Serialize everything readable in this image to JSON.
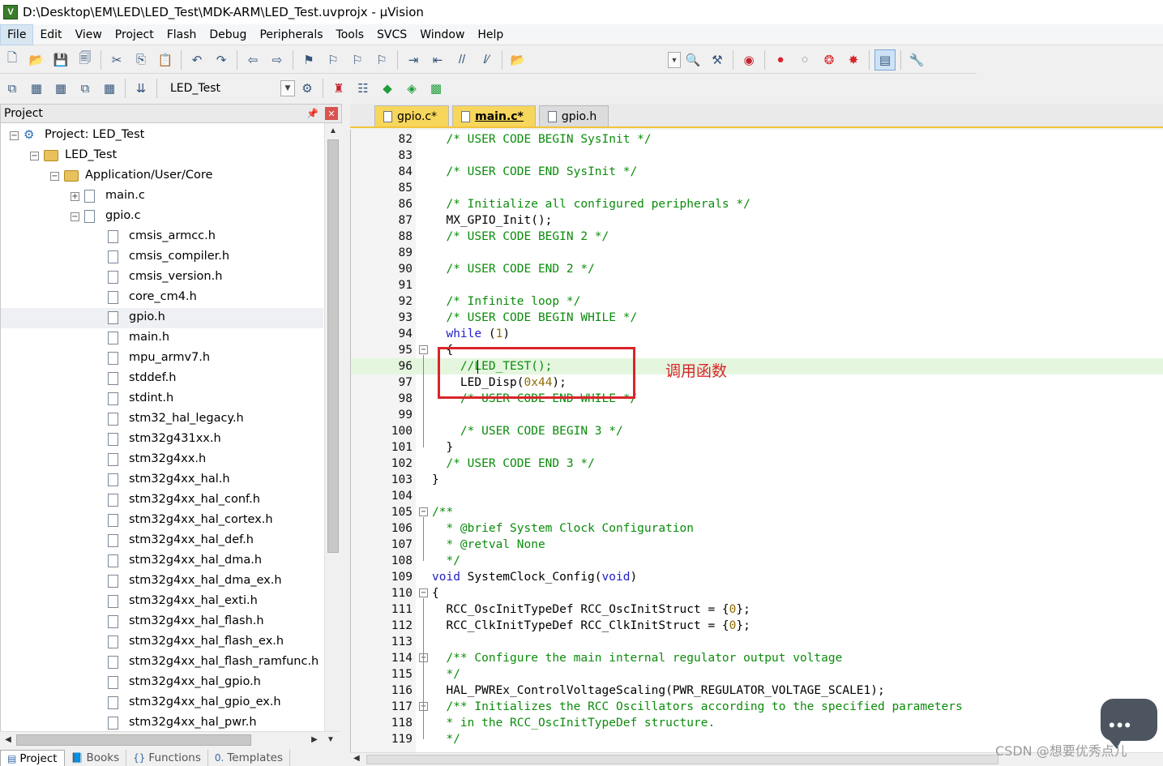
{
  "window": {
    "title": "D:\\Desktop\\EM\\LED\\LED_Test\\MDK-ARM\\LED_Test.uvprojx - µVision"
  },
  "menu": [
    "File",
    "Edit",
    "View",
    "Project",
    "Flash",
    "Debug",
    "Peripherals",
    "Tools",
    "SVCS",
    "Window",
    "Help"
  ],
  "toolbar": {
    "target": "LED_Test"
  },
  "project_pane": {
    "title": "Project",
    "tree": [
      {
        "label": "Project: LED_Test",
        "level": 0,
        "type": "project",
        "expander": "−"
      },
      {
        "label": "LED_Test",
        "level": 1,
        "type": "folder",
        "expander": "−"
      },
      {
        "label": "Application/User/Core",
        "level": 2,
        "type": "folder",
        "expander": "−"
      },
      {
        "label": "main.c",
        "level": 3,
        "type": "file",
        "expander": "+"
      },
      {
        "label": "gpio.c",
        "level": 3,
        "type": "file",
        "expander": "−"
      },
      {
        "label": "cmsis_armcc.h",
        "level": 4,
        "type": "file"
      },
      {
        "label": "cmsis_compiler.h",
        "level": 4,
        "type": "file"
      },
      {
        "label": "cmsis_version.h",
        "level": 4,
        "type": "file"
      },
      {
        "label": "core_cm4.h",
        "level": 4,
        "type": "file"
      },
      {
        "label": "gpio.h",
        "level": 4,
        "type": "file",
        "selected": true
      },
      {
        "label": "main.h",
        "level": 4,
        "type": "file"
      },
      {
        "label": "mpu_armv7.h",
        "level": 4,
        "type": "file"
      },
      {
        "label": "stddef.h",
        "level": 4,
        "type": "file"
      },
      {
        "label": "stdint.h",
        "level": 4,
        "type": "file"
      },
      {
        "label": "stm32_hal_legacy.h",
        "level": 4,
        "type": "file"
      },
      {
        "label": "stm32g431xx.h",
        "level": 4,
        "type": "file"
      },
      {
        "label": "stm32g4xx.h",
        "level": 4,
        "type": "file"
      },
      {
        "label": "stm32g4xx_hal.h",
        "level": 4,
        "type": "file"
      },
      {
        "label": "stm32g4xx_hal_conf.h",
        "level": 4,
        "type": "file"
      },
      {
        "label": "stm32g4xx_hal_cortex.h",
        "level": 4,
        "type": "file"
      },
      {
        "label": "stm32g4xx_hal_def.h",
        "level": 4,
        "type": "file"
      },
      {
        "label": "stm32g4xx_hal_dma.h",
        "level": 4,
        "type": "file"
      },
      {
        "label": "stm32g4xx_hal_dma_ex.h",
        "level": 4,
        "type": "file"
      },
      {
        "label": "stm32g4xx_hal_exti.h",
        "level": 4,
        "type": "file"
      },
      {
        "label": "stm32g4xx_hal_flash.h",
        "level": 4,
        "type": "file"
      },
      {
        "label": "stm32g4xx_hal_flash_ex.h",
        "level": 4,
        "type": "file"
      },
      {
        "label": "stm32g4xx_hal_flash_ramfunc.h",
        "level": 4,
        "type": "file"
      },
      {
        "label": "stm32g4xx_hal_gpio.h",
        "level": 4,
        "type": "file"
      },
      {
        "label": "stm32g4xx_hal_gpio_ex.h",
        "level": 4,
        "type": "file"
      },
      {
        "label": "stm32g4xx_hal_pwr.h",
        "level": 4,
        "type": "file"
      }
    ],
    "bottom_tabs": [
      {
        "label": "Project",
        "icon": "project-icon",
        "active": true
      },
      {
        "label": "Books",
        "icon": "books-icon"
      },
      {
        "label": "Functions",
        "icon": "functions-icon"
      },
      {
        "label": "Templates",
        "icon": "templates-icon"
      }
    ]
  },
  "editor": {
    "tabs": [
      {
        "label": "gpio.c*",
        "style": "yellow"
      },
      {
        "label": "main.c*",
        "style": "active"
      },
      {
        "label": "gpio.h",
        "style": "plain"
      }
    ],
    "lines": [
      {
        "n": "82",
        "indent": "  ",
        "segs": [
          [
            "cm",
            "/* USER CODE BEGIN SysInit */"
          ]
        ]
      },
      {
        "n": "83",
        "indent": "",
        "segs": []
      },
      {
        "n": "84",
        "indent": "  ",
        "segs": [
          [
            "cm",
            "/* USER CODE END SysInit */"
          ]
        ]
      },
      {
        "n": "85",
        "indent": "",
        "segs": []
      },
      {
        "n": "86",
        "indent": "  ",
        "segs": [
          [
            "cm",
            "/* Initialize all configured peripherals */"
          ]
        ]
      },
      {
        "n": "87",
        "indent": "  ",
        "segs": [
          [
            "pl",
            "MX_GPIO_Init();"
          ]
        ]
      },
      {
        "n": "88",
        "indent": "  ",
        "segs": [
          [
            "cm",
            "/* USER CODE BEGIN 2 */"
          ]
        ]
      },
      {
        "n": "89",
        "indent": "",
        "segs": []
      },
      {
        "n": "90",
        "indent": "  ",
        "segs": [
          [
            "cm",
            "/* USER CODE END 2 */"
          ]
        ]
      },
      {
        "n": "91",
        "indent": "",
        "segs": []
      },
      {
        "n": "92",
        "indent": "  ",
        "segs": [
          [
            "cm",
            "/* Infinite loop */"
          ]
        ]
      },
      {
        "n": "93",
        "indent": "  ",
        "segs": [
          [
            "cm",
            "/* USER CODE BEGIN WHILE */"
          ]
        ]
      },
      {
        "n": "94",
        "indent": "  ",
        "segs": [
          [
            "kw",
            "while"
          ],
          [
            "pl",
            " ("
          ],
          [
            "num",
            "1"
          ],
          [
            "pl",
            ")"
          ]
        ]
      },
      {
        "n": "95",
        "indent": "  ",
        "segs": [
          [
            "pl",
            "{"
          ]
        ],
        "fold": "−"
      },
      {
        "n": "96",
        "indent": "    ",
        "segs": [
          [
            "cm",
            "//LED_TEST();"
          ]
        ],
        "highlight": true
      },
      {
        "n": "97",
        "indent": "    ",
        "segs": [
          [
            "pl",
            "LED_Disp("
          ],
          [
            "num",
            "0x44"
          ],
          [
            "pl",
            ");"
          ]
        ]
      },
      {
        "n": "98",
        "indent": "    ",
        "segs": [
          [
            "cm",
            "/* USER CODE END WHILE */"
          ]
        ]
      },
      {
        "n": "99",
        "indent": "",
        "segs": []
      },
      {
        "n": "100",
        "indent": "    ",
        "segs": [
          [
            "cm",
            "/* USER CODE BEGIN 3 */"
          ]
        ]
      },
      {
        "n": "101",
        "indent": "  ",
        "segs": [
          [
            "pl",
            "}"
          ]
        ]
      },
      {
        "n": "102",
        "indent": "  ",
        "segs": [
          [
            "cm",
            "/* USER CODE END 3 */"
          ]
        ]
      },
      {
        "n": "103",
        "indent": "",
        "segs": [
          [
            "pl",
            "}"
          ]
        ]
      },
      {
        "n": "104",
        "indent": "",
        "segs": []
      },
      {
        "n": "105",
        "indent": "",
        "segs": [
          [
            "cm",
            "/**"
          ]
        ],
        "fold": "−"
      },
      {
        "n": "106",
        "indent": "  ",
        "segs": [
          [
            "cm",
            "* @brief System Clock Configuration"
          ]
        ]
      },
      {
        "n": "107",
        "indent": "  ",
        "segs": [
          [
            "cm",
            "* @retval None"
          ]
        ]
      },
      {
        "n": "108",
        "indent": "  ",
        "segs": [
          [
            "cm",
            "*/"
          ]
        ]
      },
      {
        "n": "109",
        "indent": "",
        "segs": [
          [
            "kw",
            "void"
          ],
          [
            "pl",
            " SystemClock_Config("
          ],
          [
            "kw",
            "void"
          ],
          [
            "pl",
            ")"
          ]
        ]
      },
      {
        "n": "110",
        "indent": "",
        "segs": [
          [
            "pl",
            "{"
          ]
        ],
        "fold": "−"
      },
      {
        "n": "111",
        "indent": "  ",
        "segs": [
          [
            "pl",
            "RCC_OscInitTypeDef RCC_OscInitStruct = {"
          ],
          [
            "num",
            "0"
          ],
          [
            "pl",
            "};"
          ]
        ]
      },
      {
        "n": "112",
        "indent": "  ",
        "segs": [
          [
            "pl",
            "RCC_ClkInitTypeDef RCC_ClkInitStruct = {"
          ],
          [
            "num",
            "0"
          ],
          [
            "pl",
            "};"
          ]
        ]
      },
      {
        "n": "113",
        "indent": "",
        "segs": []
      },
      {
        "n": "114",
        "indent": "  ",
        "segs": [
          [
            "cm",
            "/** Configure the main internal regulator output voltage"
          ]
        ],
        "fold": "−"
      },
      {
        "n": "115",
        "indent": "  ",
        "segs": [
          [
            "cm",
            "*/"
          ]
        ]
      },
      {
        "n": "116",
        "indent": "  ",
        "segs": [
          [
            "pl",
            "HAL_PWREx_ControlVoltageScaling(PWR_REGULATOR_VOLTAGE_SCALE1);"
          ]
        ]
      },
      {
        "n": "117",
        "indent": "  ",
        "segs": [
          [
            "cm",
            "/** Initializes the RCC Oscillators according to the specified parameters"
          ]
        ],
        "fold": "−"
      },
      {
        "n": "118",
        "indent": "  ",
        "segs": [
          [
            "cm",
            "* in the RCC_OscInitTypeDef structure."
          ]
        ]
      },
      {
        "n": "119",
        "indent": "  ",
        "segs": [
          [
            "cm",
            "*/"
          ]
        ]
      }
    ]
  },
  "annotation": {
    "text": "调用函数"
  },
  "watermark": "CSDN @想要优秀点儿",
  "colors": {
    "comment": "#0b8c0b",
    "keyword": "#2020c8",
    "number": "#8f6a00",
    "annotation": "#d9252a",
    "tab_active": "#f7d65c"
  }
}
